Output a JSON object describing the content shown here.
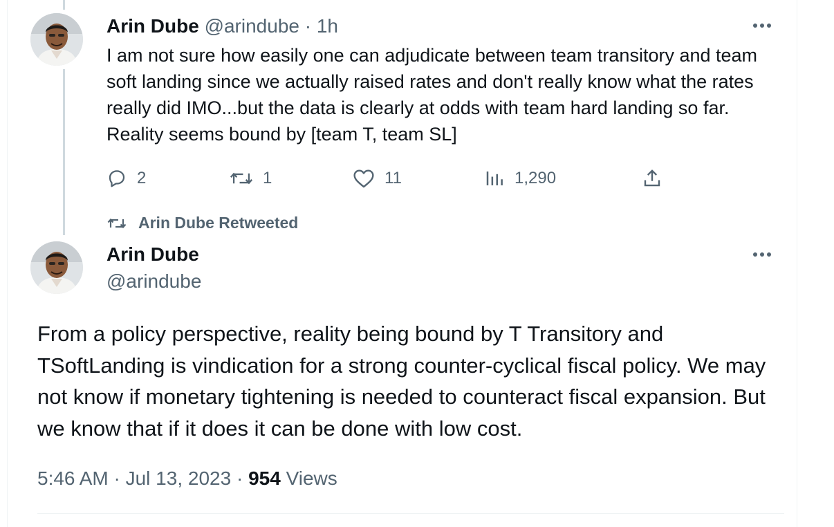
{
  "tweet1": {
    "author_name": "Arin Dube",
    "handle": "@arindube",
    "time_sep": " · ",
    "time": "1h",
    "text": "I am not sure how easily one can adjudicate between team transitory and team soft landing since we actually raised rates and don't really know what the rates really did IMO...but the data is clearly at odds with team hard landing so far. Reality seems bound by [team T, team  SL]",
    "replies": "2",
    "retweets": "1",
    "likes": "11",
    "views": "1,290"
  },
  "retweet_context": {
    "label": "Arin Dube Retweeted"
  },
  "tweet2": {
    "author_name": "Arin Dube",
    "handle": "@arindube",
    "text": "From a policy perspective, reality being bound by T Transitory and TSoftLanding is vindication for a strong counter-cyclical fiscal policy. We may not know if monetary tightening is needed to counteract fiscal expansion. But we know that if it does it can be done with low cost.",
    "timestamp": "5:46 AM · Jul 13, 2023",
    "meta_sep": " · ",
    "views_count": "954",
    "views_label": " Views"
  },
  "icons": {
    "more": "more-horizontal-icon",
    "reply": "reply-icon",
    "retweet": "retweet-icon",
    "like": "heart-icon",
    "views": "analytics-icon",
    "share": "share-icon"
  },
  "colors": {
    "text": "#0f1419",
    "muted": "#536471",
    "thread_line": "#cfd9de"
  }
}
